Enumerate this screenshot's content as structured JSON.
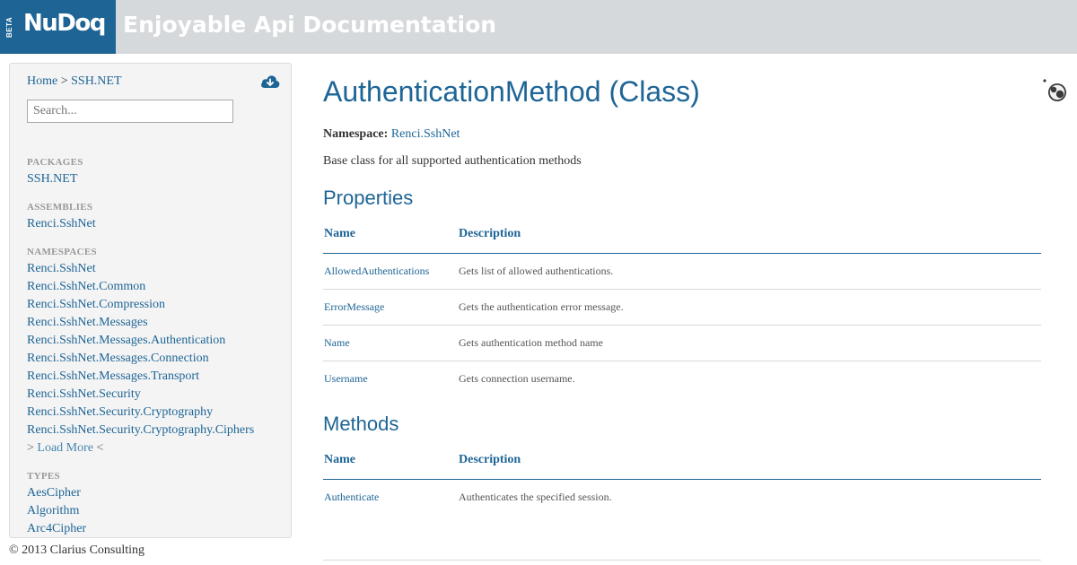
{
  "header": {
    "logo_beta": "BETA",
    "logo_text": "NuDoq",
    "tagline": "Enjoyable Api Documentation"
  },
  "sidebar": {
    "breadcrumb": {
      "home": "Home",
      "separator": ">",
      "current": "SSH.NET"
    },
    "search": {
      "placeholder": "Search..."
    },
    "packages": {
      "heading": "PACKAGES",
      "items": [
        "SSH.NET"
      ]
    },
    "assemblies": {
      "heading": "ASSEMBLIES",
      "items": [
        "Renci.SshNet"
      ]
    },
    "namespaces": {
      "heading": "NAMESPACES",
      "items": [
        "Renci.SshNet",
        "Renci.SshNet.Common",
        "Renci.SshNet.Compression",
        "Renci.SshNet.Messages",
        "Renci.SshNet.Messages.Authentication",
        "Renci.SshNet.Messages.Connection",
        "Renci.SshNet.Messages.Transport",
        "Renci.SshNet.Security",
        "Renci.SshNet.Security.Cryptography",
        "Renci.SshNet.Security.Cryptography.Ciphers"
      ],
      "load_more": {
        "prefix": ">",
        "label": "Load More",
        "suffix": "<"
      }
    },
    "types": {
      "heading": "TYPES",
      "items": [
        "AesCipher",
        "Algorithm",
        "Arc4Cipher"
      ]
    }
  },
  "footer": {
    "copyright": "© 2013 Clarius Consulting"
  },
  "main": {
    "title": "AuthenticationMethod (Class)",
    "namespace_label": "Namespace:",
    "namespace_value": "Renci.SshNet",
    "summary": "Base class for all supported authentication methods",
    "properties": {
      "heading": "Properties",
      "columns": [
        "Name",
        "Description"
      ],
      "rows": [
        {
          "name": "AllowedAuthentications",
          "description": "Gets list of allowed authentications."
        },
        {
          "name": "ErrorMessage",
          "description": "Gets the authentication error message."
        },
        {
          "name": "Name",
          "description": "Gets authentication method name"
        },
        {
          "name": "Username",
          "description": "Gets connection username."
        }
      ]
    },
    "methods": {
      "heading": "Methods",
      "columns": [
        "Name",
        "Description"
      ],
      "rows": [
        {
          "name": "Authenticate",
          "description": "Authenticates the specified session."
        }
      ]
    }
  },
  "colors": {
    "brand_blue": "#1e6596",
    "header_gray": "#d5d9dc",
    "sidebar_bg": "#f4f4f4"
  }
}
